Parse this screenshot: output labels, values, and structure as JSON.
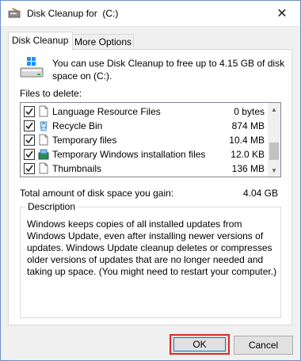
{
  "window": {
    "title": "Disk Cleanup for  (C:)",
    "close_label": "✕"
  },
  "tabs": [
    {
      "label": "Disk Cleanup",
      "active": true
    },
    {
      "label": "More Options",
      "active": false
    }
  ],
  "intro": "You can use Disk Cleanup to free up to 4.15 GB of disk space on  (C:).",
  "files_label": "Files to delete:",
  "files": [
    {
      "name": "Language Resource Files",
      "size": "0 bytes",
      "checked": true,
      "icon": "blank-file-icon"
    },
    {
      "name": "Recycle Bin",
      "size": "874 MB",
      "checked": true,
      "icon": "recycle-bin-icon"
    },
    {
      "name": "Temporary files",
      "size": "10.4 MB",
      "checked": true,
      "icon": "blank-file-icon"
    },
    {
      "name": "Temporary Windows installation files",
      "size": "12.0 KB",
      "checked": true,
      "icon": "windows-install-icon"
    },
    {
      "name": "Thumbnails",
      "size": "136 MB",
      "checked": true,
      "icon": "blank-file-icon"
    }
  ],
  "total": {
    "label": "Total amount of disk space you gain:",
    "value": "4.04 GB"
  },
  "description": {
    "title": "Description",
    "text": "Windows keeps copies of all installed updates from Windows Update, even after installing newer versions of updates. Windows Update cleanup deletes or compresses older versions of updates that are no longer needed and taking up space. (You might need to restart your computer.)"
  },
  "buttons": {
    "ok": "OK",
    "cancel": "Cancel"
  },
  "colors": {
    "ok_highlight": "#d72b2b",
    "focus": "#0078d7"
  }
}
